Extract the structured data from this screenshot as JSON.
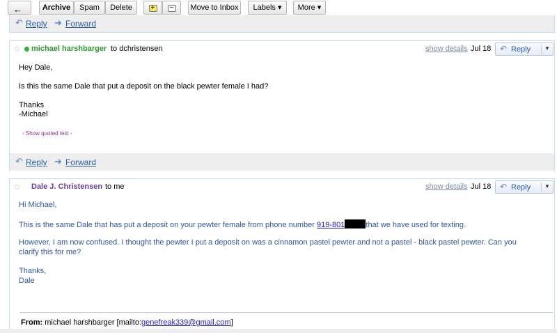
{
  "toolbar": {
    "archive": "Archive",
    "spam": "Spam",
    "delete": "Delete",
    "move_to_inbox": "Move to Inbox",
    "labels": "Labels ▾",
    "more": "More ▾"
  },
  "top_footer": {
    "reply": "Reply",
    "forward": "Forward"
  },
  "message1": {
    "sender": "michael harshbarger",
    "to": "to dchristensen",
    "show_details": "show details",
    "date": "Jul 18",
    "reply_btn": "Reply",
    "greeting": "Hey Dale,",
    "line1": "Is this the same Dale that put a deposit on the black pewter female I had?",
    "thanks": "Thanks",
    "signature": "-Michael",
    "show_quoted": "- Show quoted text -",
    "reply": "Reply",
    "forward": "Forward"
  },
  "message2": {
    "sender": "Dale J. Christensen",
    "to": "to me",
    "show_details": "show details",
    "date": "Jul 18",
    "reply_btn": "Reply",
    "greeting": "Hi Michael,",
    "line1_pre": "This is the same Dale that has put a deposit on your pewter female from phone number ",
    "phone": "919-801",
    "line1_post": "that we have used for texting.",
    "line2": "However, I am now confused.  I thought the pewter I put a deposit on was a cinnamon pastel pewter and not a pastel - black pastel pewter. Can you",
    "line3": "clarify this for me?",
    "thanks": "Thanks,",
    "signature": "Dale",
    "from_label": "From:",
    "from_name": " michael harshbarger [mailto:",
    "from_email": "genefreak339@gmail.com",
    "from_close": "]"
  },
  "colors": {
    "accent_blue": "#2a5db0",
    "quoted_blue": "#2b57a6",
    "online_dot": "#2fb52f",
    "border": "#c3d9ff"
  }
}
